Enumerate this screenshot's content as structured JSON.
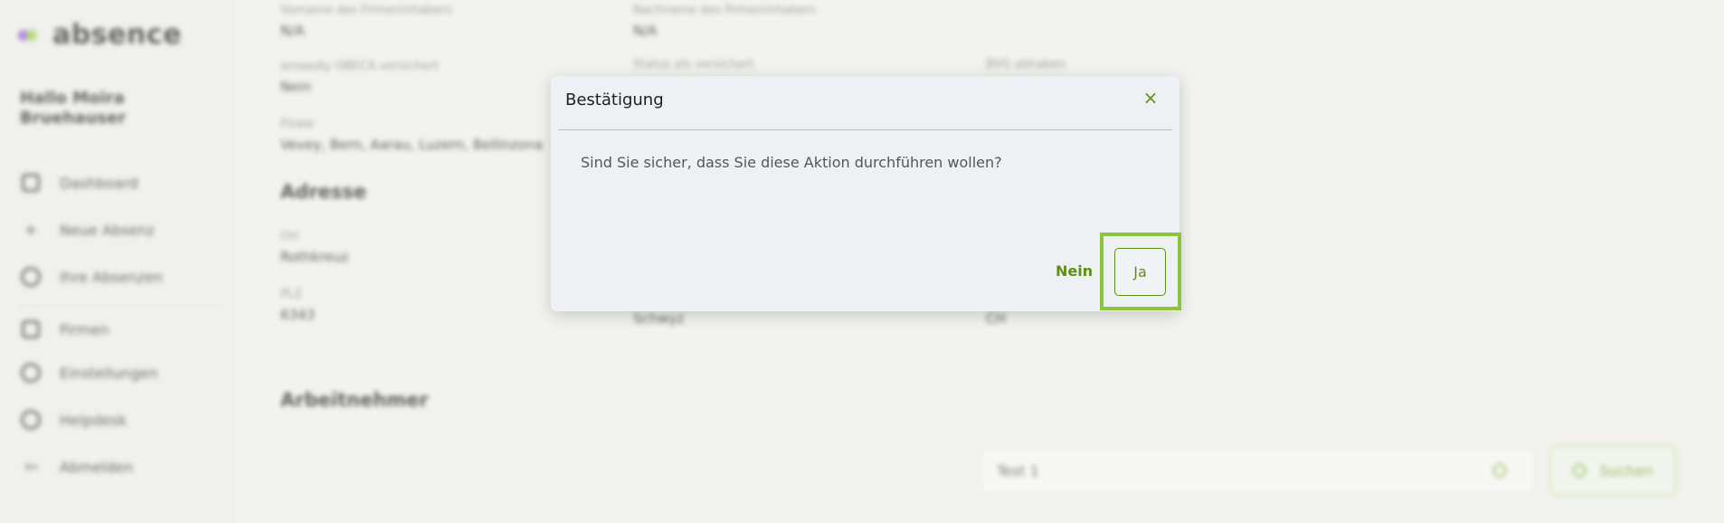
{
  "app": {
    "logo_text": "absence",
    "greeting_line1": "Hallo Moira",
    "greeting_line2": "Bruehauser"
  },
  "sidebar": {
    "items": [
      {
        "label": "Dashboard",
        "icon": "dashboard-icon"
      },
      {
        "label": "Neue Absenz",
        "icon": "plus-icon"
      },
      {
        "label": "Ihre Absenzen",
        "icon": "globe-icon"
      },
      {
        "label": "Firmen",
        "icon": "building-icon"
      },
      {
        "label": "Einstellungen",
        "icon": "gear-icon"
      },
      {
        "label": "Helpdesk",
        "icon": "clock-icon"
      },
      {
        "label": "Abmelden",
        "icon": "logout-icon"
      }
    ]
  },
  "details": {
    "vorname_label": "Vorname des Firmeninhabers",
    "vorname_value": "N/A",
    "nachname_label": "Nachname des Firmeninhabers",
    "nachname_value": "N/A",
    "obsg_label": "amaadly OBECA versichert",
    "obsg_value": "Nein",
    "status_label": "Status als versichert",
    "bvg_label": "BVG abhaben",
    "filiale_label": "Filiale",
    "filiale_value": "Vevey, Bern, Aarau, Luzern, Bellinzona",
    "adresse_title": "Adresse",
    "ort_label": "Ort",
    "ort_value": "Rothkreuz",
    "plz_label": "PLZ",
    "plz_value": "6343",
    "kanton_value": "Schwyz",
    "land_value": "CH",
    "arbeitnehmer_title": "Arbeitnehmer"
  },
  "search": {
    "value": "Test 1",
    "button_label": "Suchen"
  },
  "dialog": {
    "title": "Bestätigung",
    "close_symbol": "×",
    "message": "Sind Sie sicher, dass Sie diese Aktion durchführen wollen?",
    "no_label": "Nein",
    "yes_label": "Ja"
  },
  "colors": {
    "accent": "#5e8f16",
    "highlight": "#8cc43c",
    "dialog_bg": "#eef1f4",
    "page_bg": "#f3f3ef"
  }
}
